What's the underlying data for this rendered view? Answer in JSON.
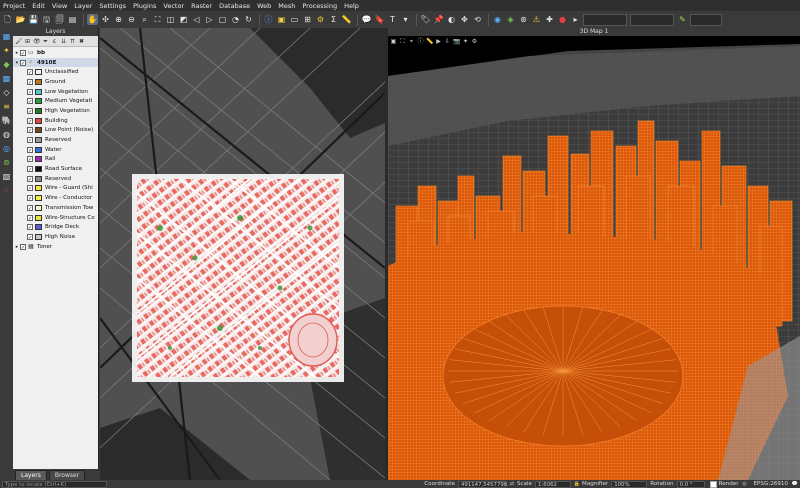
{
  "menu": [
    "Project",
    "Edit",
    "View",
    "Layer",
    "Settings",
    "Plugins",
    "Vector",
    "Raster",
    "Database",
    "Web",
    "Mesh",
    "Processing",
    "Help"
  ],
  "layers_panel": {
    "title": "Layers",
    "items": [
      {
        "name": "bb",
        "level": 0,
        "bold": true,
        "checked": true,
        "kind": "vector"
      },
      {
        "name": "4910E",
        "level": 0,
        "bold": true,
        "checked": true,
        "kind": "pointcloud",
        "selected": true
      },
      {
        "name": "Unclassified",
        "level": 1,
        "checked": true,
        "color": "#f2f2f2"
      },
      {
        "name": "Ground",
        "level": 1,
        "checked": true,
        "color": "#c0751f"
      },
      {
        "name": "Low Vegetation",
        "level": 1,
        "checked": true,
        "color": "#4fcbd0"
      },
      {
        "name": "Medium Vegetati",
        "level": 1,
        "checked": true,
        "color": "#2e9a3a"
      },
      {
        "name": "High Vegetation",
        "level": 1,
        "checked": true,
        "color": "#1f7d24"
      },
      {
        "name": "Building",
        "level": 1,
        "checked": true,
        "color": "#e8443b"
      },
      {
        "name": "Low Point (Noise)",
        "level": 1,
        "checked": true,
        "color": "#7a4a1f"
      },
      {
        "name": "Reserved",
        "level": 1,
        "checked": true,
        "color": "#9a9a9a"
      },
      {
        "name": "Water",
        "level": 1,
        "checked": true,
        "color": "#2f6fe0"
      },
      {
        "name": "Rail",
        "level": 1,
        "checked": true,
        "color": "#a228a8"
      },
      {
        "name": "Road Surface",
        "level": 1,
        "checked": true,
        "color": "#111111"
      },
      {
        "name": "Reserved",
        "level": 1,
        "checked": true,
        "color": "#8a8a8a"
      },
      {
        "name": "Wire - Guard (Shi",
        "level": 1,
        "checked": true,
        "color": "#f2e43a"
      },
      {
        "name": "Wire - Conductor",
        "level": 1,
        "checked": true,
        "color": "#f2f23a"
      },
      {
        "name": "Transmission Tow",
        "level": 1,
        "checked": true,
        "color": "#f5f5d0"
      },
      {
        "name": "Wire-Structure Co",
        "level": 1,
        "checked": true,
        "color": "#e6e640"
      },
      {
        "name": "Bridge Deck",
        "level": 1,
        "checked": true,
        "color": "#5d5de0"
      },
      {
        "name": "High Noise",
        "level": 1,
        "checked": true,
        "color": "#c8c8c8"
      },
      {
        "name": "Toner",
        "level": 0,
        "bold": false,
        "checked": true,
        "kind": "raster"
      }
    ],
    "tabs": [
      "Layers",
      "Browser"
    ]
  },
  "map3d": {
    "title": "3D Map 1"
  },
  "status": {
    "locator_placeholder": "Type to locate (Ctrl+K)",
    "coordinate_label": "Coordinate",
    "coordinate": "491147,5457796",
    "scale_label": "Scale",
    "scale": "1:6062",
    "magnifier_label": "Magnifier",
    "magnifier": "100%",
    "rotation_label": "Rotation",
    "rotation": "0.0 °",
    "render_label": "Render",
    "crs": "EPSG:26910"
  },
  "colors": {
    "pointcloud_3d": "#e2620f",
    "building_2d": "#e8443b",
    "veg_2d": "#2e9a3a"
  }
}
